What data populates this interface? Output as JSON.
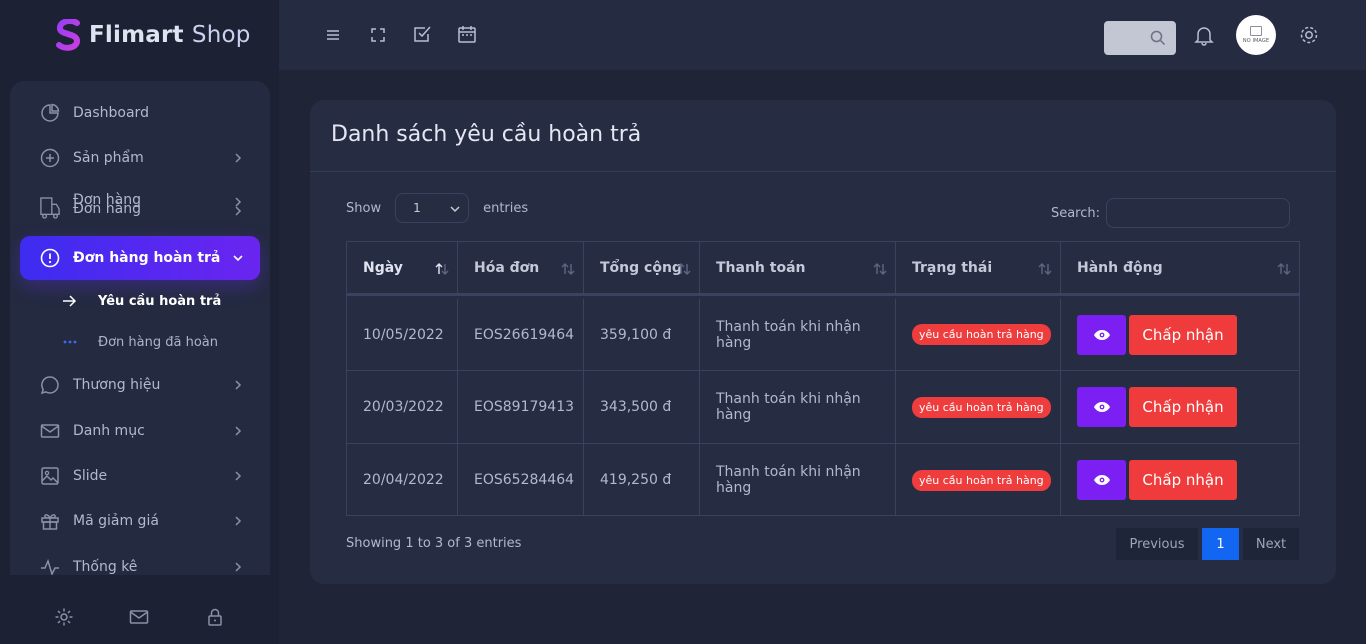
{
  "brand": {
    "name": "Flimart",
    "suffix": "Shop"
  },
  "sidebar": {
    "items": [
      {
        "label": "Dashboard",
        "icon": "pie-chart-icon"
      },
      {
        "label": "Sản phẩm",
        "icon": "plus-circle-icon"
      },
      {
        "label": "Đơn hàng",
        "label_overlap": "Đơn hàng",
        "icon": "truck-icon"
      },
      {
        "label": "Đơn hàng hoàn trả",
        "icon": "alert-circle-icon"
      },
      {
        "label": "Thương hiệu",
        "icon": "message-circle-icon"
      },
      {
        "label": "Danh mục",
        "icon": "mail-icon"
      },
      {
        "label": "Slide",
        "icon": "image-icon"
      },
      {
        "label": "Mã giảm giá",
        "icon": "gift-icon"
      },
      {
        "label": "Thống kê",
        "icon": "activity-icon"
      }
    ],
    "subitems": [
      {
        "label": "Yêu cầu hoàn trả",
        "icon": "arrow-right-icon"
      },
      {
        "label": "Đơn hàng đã hoàn",
        "icon": "dots-icon"
      }
    ],
    "footer": [
      "gear-icon",
      "mail-icon",
      "lock-icon"
    ]
  },
  "topbar": {
    "icons": [
      "menu-icon",
      "fullscreen-icon",
      "checkbox-icon",
      "calendar-icon"
    ],
    "avatar_text": "NO IMAGE"
  },
  "card": {
    "title": "Danh sách yêu cầu hoàn trả",
    "show_label": "Show",
    "entries_value": "1",
    "entries_label": "entries",
    "search_label": "Search:",
    "search_value": ""
  },
  "table": {
    "headers": [
      "Ngày",
      "Hóa đơn",
      "Tổng cộng",
      "Thanh toán",
      "Trạng thái",
      "Hành động"
    ],
    "rows": [
      {
        "date": "10/05/2022",
        "invoice": "EOS26619464",
        "total": "359,100 đ",
        "payment": "Thanh toán khi nhận hàng",
        "status": "yêu cầu hoàn trả hàng",
        "action": "Chấp nhận"
      },
      {
        "date": "20/03/2022",
        "invoice": "EOS89179413",
        "total": "343,500 đ",
        "payment": "Thanh toán khi nhận hàng",
        "status": "yêu cầu hoàn trả hàng",
        "action": "Chấp nhận"
      },
      {
        "date": "20/04/2022",
        "invoice": "EOS65284464",
        "total": "419,250 đ",
        "payment": "Thanh toán khi nhận hàng",
        "status": "yêu cầu hoàn trả hàng",
        "action": "Chấp nhận"
      }
    ]
  },
  "footer": {
    "info": "Showing 1 to 3 of 3 entries",
    "previous": "Previous",
    "page": "1",
    "next": "Next"
  },
  "colors": {
    "accent": "#6a25f0",
    "danger": "#ef3b3b",
    "view_button": "#7b1ff2",
    "page_active": "#1266f1"
  }
}
